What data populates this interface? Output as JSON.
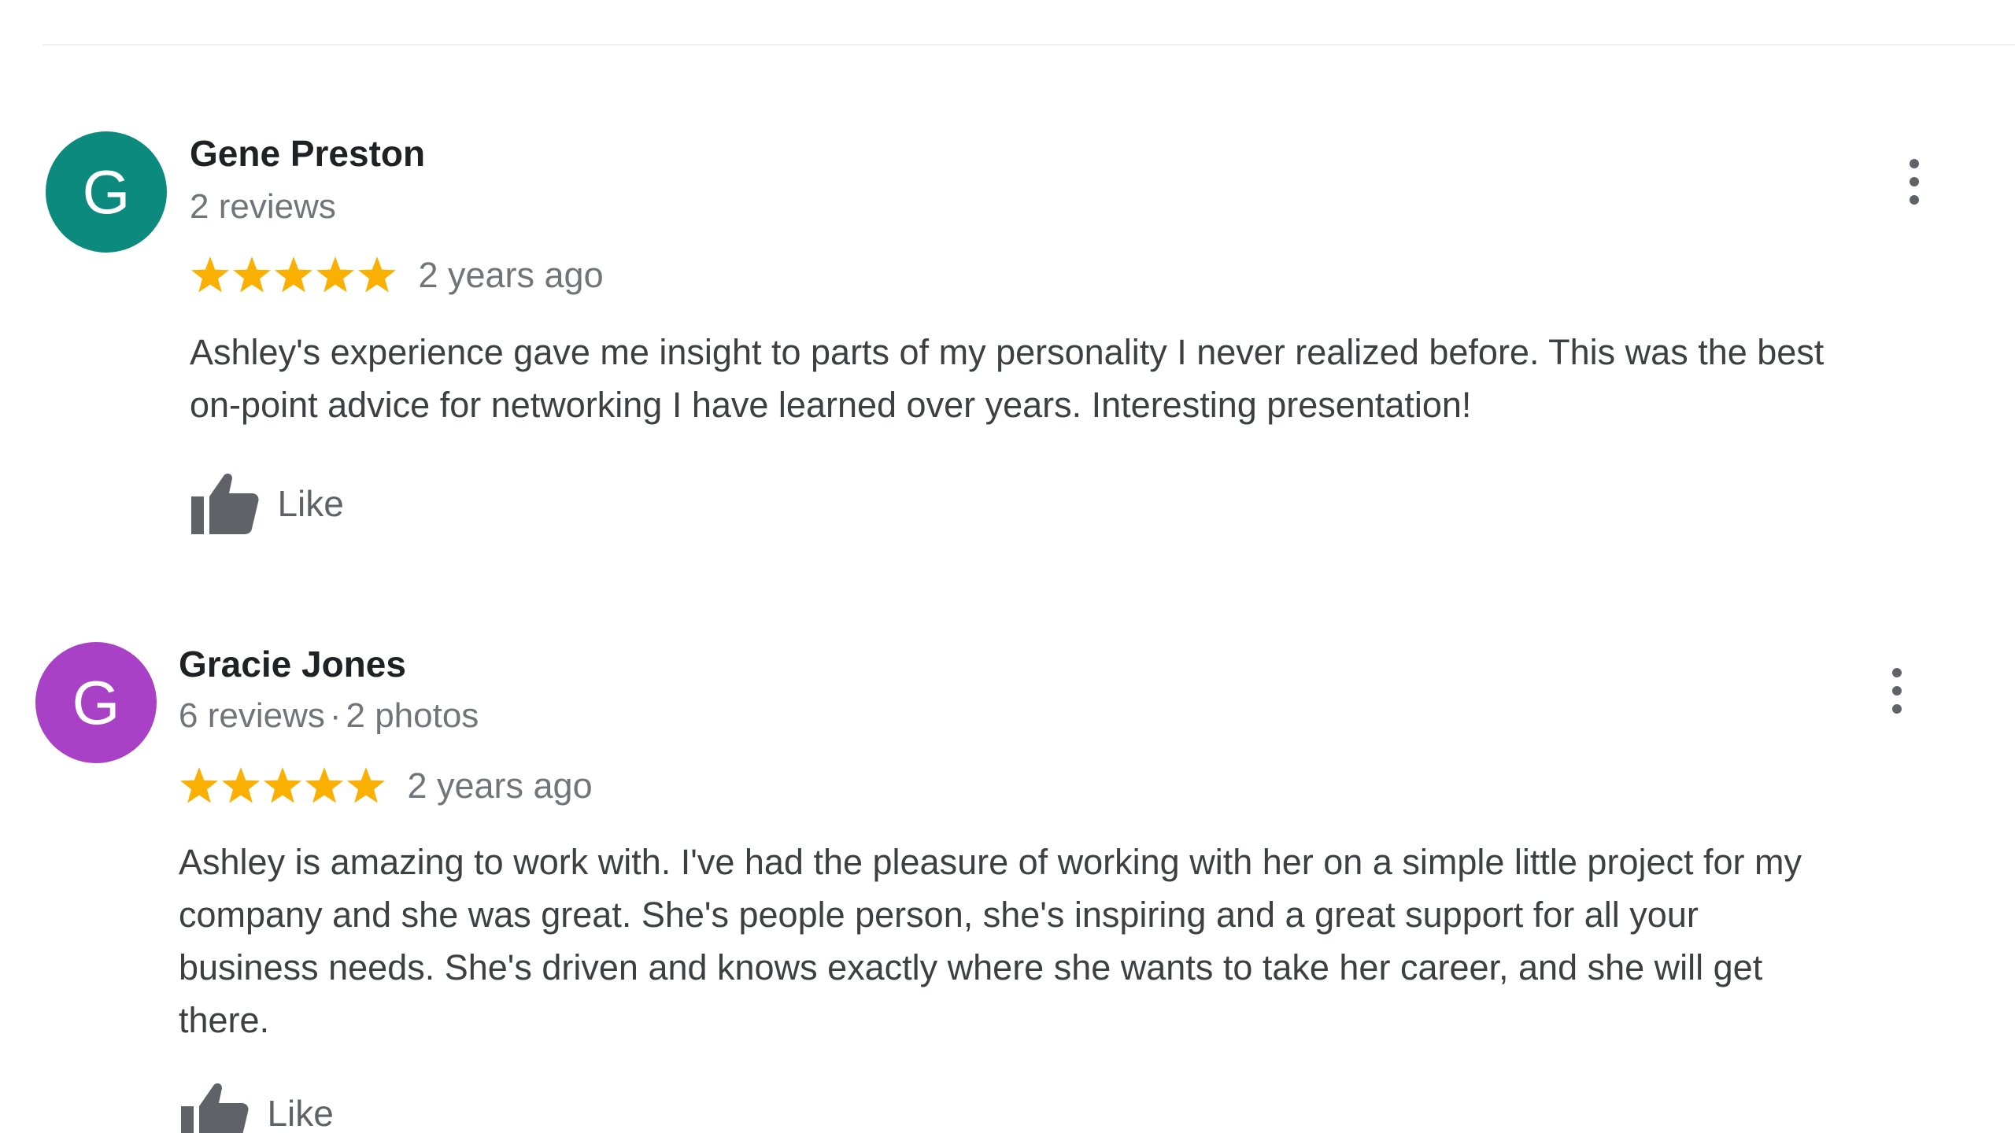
{
  "reviews": [
    {
      "avatar_letter": "G",
      "avatar_color": "#0b8a7d",
      "name": "Gene Preston",
      "meta": [
        "2 reviews"
      ],
      "stars": 5,
      "time": "2 years ago",
      "text": "Ashley's experience gave me insight to parts of my personality I never realized before.  This was the best\non-point advice for networking I have learned over years.  Interesting presentation!",
      "like_label": "Like",
      "icons": {
        "more": "more-vert-icon",
        "like": "thumb-up-icon",
        "star": "star-icon"
      }
    },
    {
      "avatar_letter": "G",
      "avatar_color": "#a941c7",
      "name": "Gracie Jones",
      "meta": [
        "6 reviews",
        "2 photos"
      ],
      "meta_separator": "·",
      "stars": 5,
      "time": "2 years ago",
      "text": "Ashley is amazing to work with.  I've had the pleasure of working with her on a simple little project for my\ncompany and she was great.  She's  people person, she's inspiring and a great support for all your\nbusiness needs.  She's driven and knows exactly where she wants to take her career, and she will get\nthere.",
      "like_label": "Like",
      "icons": {
        "more": "more-vert-icon",
        "like": "thumb-up-icon",
        "star": "star-icon"
      }
    }
  ],
  "colors": {
    "star": "#f9b000",
    "icon_gray": "#5f6368",
    "name": "#202124",
    "secondary": "#70757a"
  }
}
